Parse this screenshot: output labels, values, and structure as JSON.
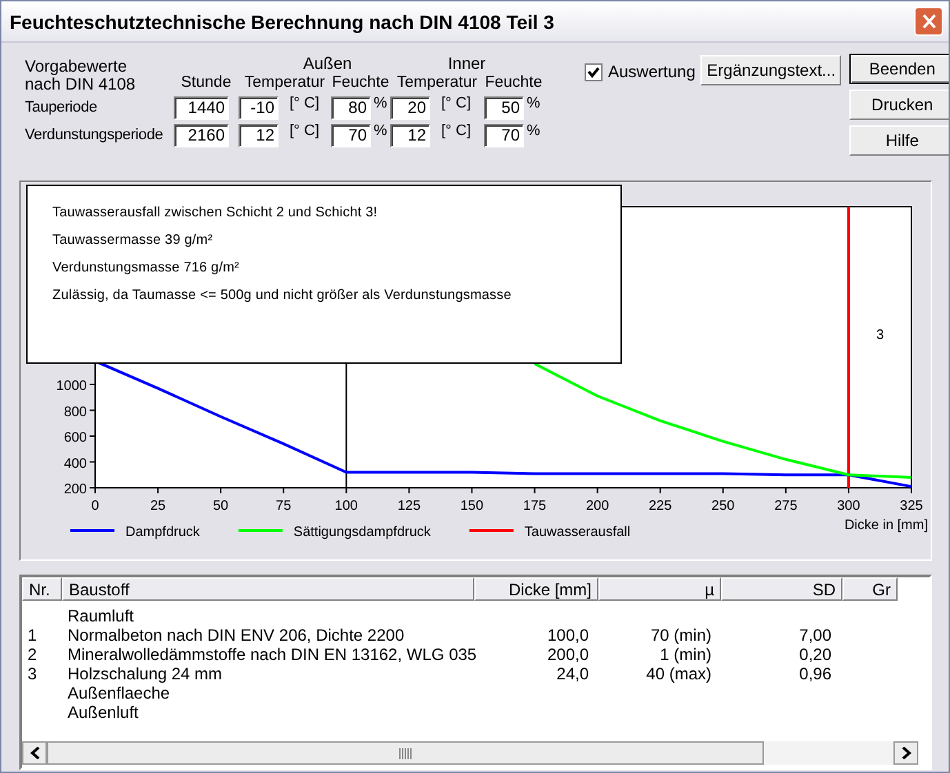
{
  "window": {
    "title": "Feuchteschutztechnische Berechnung nach DIN 4108 Teil 3"
  },
  "settings": {
    "caption": "Vorgabewerte\nnach DIN 4108",
    "groups": [
      "Außen",
      "Inner"
    ],
    "columns": [
      "Stunde",
      "Temperatur",
      "Feuchte",
      "Temperatur",
      "Feuchte"
    ],
    "periods": [
      {
        "label": "Tauperiode",
        "hours": "1440",
        "outer_temp": "-10",
        "outer_temp_unit": "[° C]",
        "outer_humidity": "80",
        "outer_humidity_unit": "%",
        "inner_temp": "20",
        "inner_temp_unit": "[° C]",
        "inner_humidity": "50",
        "inner_humidity_unit": "%"
      },
      {
        "label": "Verdunstungsperiode",
        "hours": "2160",
        "outer_temp": "12",
        "outer_temp_unit": "[° C]",
        "outer_humidity": "70",
        "outer_humidity_unit": "%",
        "inner_temp": "12",
        "inner_temp_unit": "[° C]",
        "inner_humidity": "70",
        "inner_humidity_unit": "%"
      }
    ]
  },
  "evaluation": {
    "label": "Auswertung",
    "checked": true
  },
  "supplement_button": "Ergänzungstext...",
  "buttons": [
    {
      "label": "Beenden",
      "default": true
    },
    {
      "label": "Drucken",
      "default": false
    },
    {
      "label": "Hilfe",
      "default": false
    }
  ],
  "result_box": {
    "lines": [
      "Tauwasserausfall zwischen Schicht 2 und Schicht 3!",
      "Tauwassermasse  39 g/m²",
      "Verdunstungsmasse 716 g/m²",
      "Zulässig, da Taumasse <= 500g und nicht größer als Verdunstungsmasse"
    ]
  },
  "chart": {
    "chart_data": {
      "type": "line",
      "xlabel": "Dicke in [mm]",
      "x": [
        0,
        25,
        50,
        75,
        100,
        125,
        150,
        175,
        200,
        225,
        250,
        275,
        300,
        325
      ],
      "series": [
        {
          "name": "Dampfdruck",
          "color": "#0000ff",
          "values": [
            1180,
            970,
            750,
            540,
            320,
            320,
            320,
            310,
            310,
            310,
            310,
            300,
            300,
            210
          ]
        },
        {
          "name": "Sättigungsdampfdruck",
          "color": "#00ff00",
          "values": [
            null,
            null,
            null,
            null,
            null,
            null,
            null,
            1160,
            910,
            720,
            560,
            420,
            300,
            280
          ]
        }
      ],
      "legend": "bottom",
      "ref_lines": [
        {
          "axis": "x",
          "value": 100,
          "color": "#000000"
        },
        {
          "axis": "x",
          "value": 300,
          "color": "#ff0000",
          "label": "Tauwasserausfall"
        }
      ],
      "xlim": [
        0,
        325
      ],
      "ylim": [
        200,
        2376
      ],
      "xticks": [
        0,
        25,
        50,
        75,
        100,
        125,
        150,
        175,
        200,
        225,
        250,
        275,
        300,
        325
      ],
      "yticks": [
        200,
        400,
        600,
        800,
        1000
      ],
      "annotations": [
        "3"
      ]
    }
  },
  "table": {
    "columns": [
      "Nr.",
      "Baustoff",
      "Dicke [mm]",
      "µ",
      "SD",
      "Gr"
    ],
    "rows": [
      {
        "material": "Raumluft"
      },
      {
        "nr": "1",
        "material": "Normalbeton nach DIN ENV 206, Dichte 2200",
        "thickness": "100,0",
        "mu": "70 (min)",
        "sd": "7,00"
      },
      {
        "nr": "2",
        "material": "Mineralwolledämmstoffe nach DIN EN 13162, WLG 035",
        "thickness": "200,0",
        "mu": "1 (min)",
        "sd": "0,20"
      },
      {
        "nr": "3",
        "material": "Holzschalung 24 mm",
        "thickness": "24,0",
        "mu": "40 (max)",
        "sd": "0,96"
      },
      {
        "material": "Außenflaeche"
      },
      {
        "material": "Außenluft"
      }
    ]
  }
}
